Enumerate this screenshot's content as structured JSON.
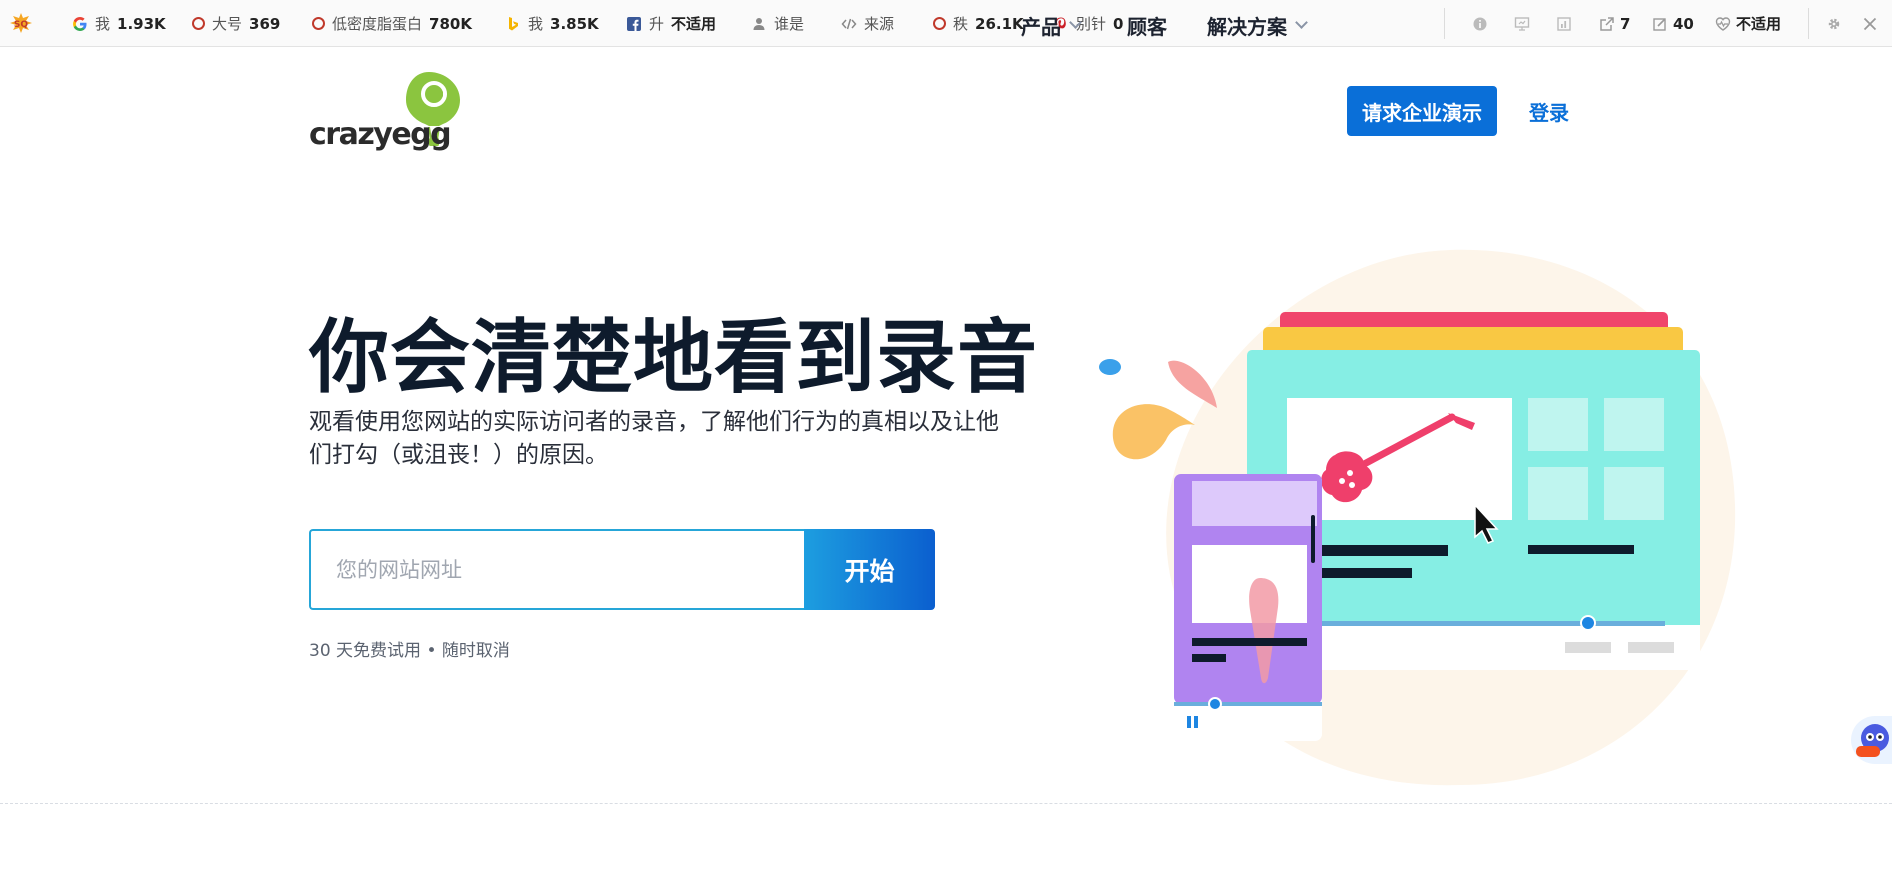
{
  "seobar": {
    "items": [
      {
        "icon": "google-icon",
        "label": "我",
        "value": "1.93K"
      },
      {
        "icon": "ring-icon",
        "label": "大号",
        "value": "369"
      },
      {
        "icon": "ring-icon",
        "label": "低密度脂蛋白",
        "value": "780K"
      },
      {
        "icon": "bing-icon",
        "label": "我",
        "value": "3.85K"
      },
      {
        "icon": "facebook-icon",
        "label": "升",
        "value": "不适用"
      },
      {
        "icon": "user-icon",
        "label": "谁是",
        "value": ""
      },
      {
        "icon": "code-icon",
        "label": "来源",
        "value": ""
      },
      {
        "icon": "ring-icon",
        "label": "秩",
        "value": "26.1K"
      },
      {
        "icon": "pinterest-icon",
        "label": "别针",
        "value": "0"
      }
    ],
    "right": {
      "external_links": "7",
      "internal_links": "40",
      "health": "不适用"
    }
  },
  "header": {
    "logo_text": "crazyegg",
    "nav": {
      "products": "产品",
      "customers": "顾客",
      "solutions": "解决方案"
    },
    "demo_button": "请求企业演示",
    "login": "登录"
  },
  "hero": {
    "title": "你会清楚地看到录音",
    "subtitle": "观看使用您网站的实际访问者的录音，了解他们行为的真相以及让他们打勾（或沮丧！）的原因。",
    "url_placeholder": "您的网站网址",
    "start_button": "开始",
    "trial_text": "30 天免费试用 • 随时取消"
  },
  "colors": {
    "accent": "#0a6fd8",
    "title": "#0e1b2c",
    "input_border": "#26a6d8",
    "teal": "#86eee4",
    "purple": "#b084f0",
    "guitar": "#ef3f6b"
  }
}
